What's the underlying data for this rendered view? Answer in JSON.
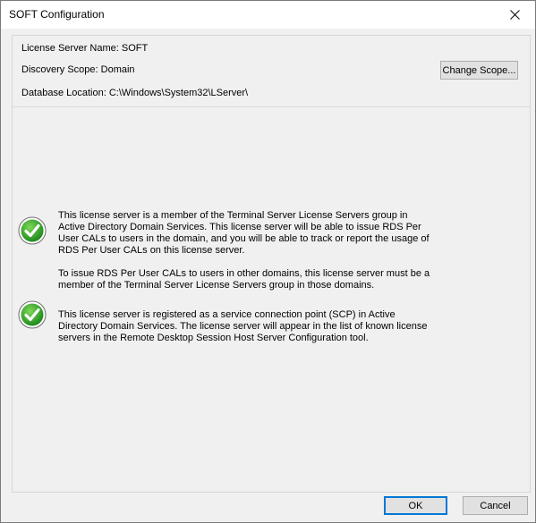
{
  "window": {
    "title": "SOFT Configuration"
  },
  "info": {
    "server_name": "License Server Name: SOFT",
    "discovery_scope": "Discovery Scope: Domain",
    "database_location": "Database Location: C:\\Windows\\System32\\LServer\\"
  },
  "buttons": {
    "change_scope": "Change Scope...",
    "ok": "OK",
    "cancel": "Cancel"
  },
  "statuses": [
    {
      "icon": "check-icon",
      "paragraphs": [
        "This license server is a member of the Terminal Server License Servers group in Active Directory Domain Services. This license server will be able to issue RDS Per User CALs to users in the domain, and you will be able to track or report the usage of RDS Per User CALs on this license server.",
        "To issue RDS Per User CALs to users in other domains, this license server must be a member of the Terminal Server License Servers group in those domains."
      ]
    },
    {
      "icon": "check-icon",
      "paragraphs": [
        "This license server is registered as a service connection point (SCP) in Active Directory Domain Services. The license server will appear in the list of known license servers in the Remote Desktop Session Host Server Configuration tool."
      ]
    }
  ],
  "colors": {
    "check_green": "#2e9a2e",
    "check_ring": "#6e6e6e",
    "default_button_border": "#0078d7"
  }
}
